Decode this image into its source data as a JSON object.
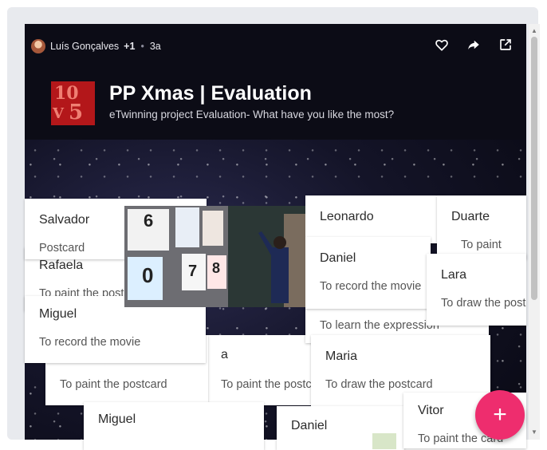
{
  "header": {
    "author": "Luís Gonçalves",
    "coauthors": "+1",
    "age": "3a",
    "title": "PP Xmas | Evaluation",
    "subtitle": "eTwinning project Evaluation- What have you like the most?",
    "icons": [
      "heart-icon",
      "share-icon",
      "open-external-icon"
    ]
  },
  "logo_text": "10",
  "cards": {
    "salvador": {
      "name": "Salvador",
      "body": "Postcard"
    },
    "rafaela": {
      "name": "Rafaela",
      "body": "To paint the postcard"
    },
    "miguel1": {
      "name": "Miguel",
      "body": "To record the movie"
    },
    "c_a": {
      "name": "a",
      "body": "To paint the postcard"
    },
    "left_bottom": {
      "body": "To paint the postcard"
    },
    "miguel2": {
      "name": "Miguel"
    },
    "leonardo": {
      "name": "Leonardo"
    },
    "daniel1": {
      "name": "Daniel",
      "body": "To record the movie"
    },
    "learn": {
      "body": "To learn the expression"
    },
    "duarte": {
      "name": "Duarte",
      "body": "To paint"
    },
    "lara": {
      "name": "Lara",
      "body": "To draw the postcard"
    },
    "maria": {
      "name": "Maria",
      "body": "To draw the postcard"
    },
    "daniel2": {
      "name": "Daniel"
    },
    "vitor": {
      "name": "Vitor",
      "body": "To paint the card"
    }
  },
  "photo_digits": [
    "6",
    "0",
    "7",
    "8"
  ],
  "fab_label": "+",
  "scroll_up": "▲",
  "scroll_down": "▼"
}
